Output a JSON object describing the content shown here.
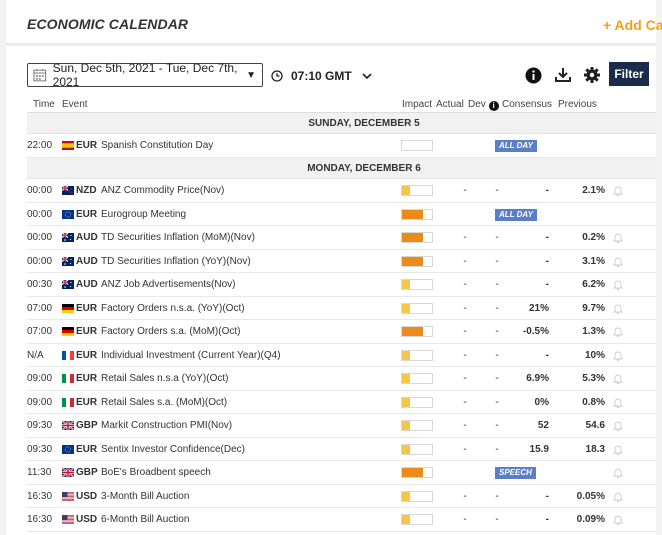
{
  "header": {
    "title": "ECONOMIC CALENDAR",
    "add_calendar": "+ Add Ca"
  },
  "toolbar": {
    "date_range": "Sun, Dec 5th, 2021 -  Tue, Dec 7th, 2021",
    "timezone": "07:10 GMT",
    "filter_label": "Filter"
  },
  "columns": {
    "time": "Time",
    "event": "Event",
    "impact": "Impact",
    "actual": "Actual",
    "dev": "Dev",
    "consensus": "Consensus",
    "previous": "Previous"
  },
  "days": [
    {
      "label": "SUNDAY, DECEMBER 5",
      "events": [
        {
          "time": "22:00",
          "flag": "es",
          "currency": "EUR",
          "event": "Spanish Constitution Day",
          "impact": 0,
          "tag": "ALL DAY",
          "actual": "",
          "dev": "",
          "consensus": "",
          "previous": "",
          "bell": false
        }
      ]
    },
    {
      "label": "MONDAY, DECEMBER 6",
      "events": [
        {
          "time": "00:00",
          "flag": "nz",
          "currency": "NZD",
          "event": "ANZ Commodity Price(Nov)",
          "impact": 0.25,
          "tag": "",
          "actual": "-",
          "dev": "-",
          "consensus": "-",
          "previous": "2.1%",
          "bell": true
        },
        {
          "time": "00:00",
          "flag": "eu",
          "currency": "EUR",
          "event": "Eurogroup Meeting",
          "impact": 0.7,
          "tag": "ALL DAY",
          "actual": "",
          "dev": "",
          "consensus": "",
          "previous": "",
          "bell": false
        },
        {
          "time": "00:00",
          "flag": "au",
          "currency": "AUD",
          "event": "TD Securities Inflation (MoM)(Nov)",
          "impact": 0.7,
          "tag": "",
          "actual": "-",
          "dev": "-",
          "consensus": "-",
          "previous": "0.2%",
          "bell": true
        },
        {
          "time": "00:00",
          "flag": "au",
          "currency": "AUD",
          "event": "TD Securities Inflation (YoY)(Nov)",
          "impact": 0.7,
          "tag": "",
          "actual": "-",
          "dev": "-",
          "consensus": "-",
          "previous": "3.1%",
          "bell": true
        },
        {
          "time": "00:30",
          "flag": "au",
          "currency": "AUD",
          "event": "ANZ Job Advertisements(Nov)",
          "impact": 0.25,
          "tag": "",
          "actual": "-",
          "dev": "-",
          "consensus": "-",
          "previous": "6.2%",
          "bell": true
        },
        {
          "time": "07:00",
          "flag": "de",
          "currency": "EUR",
          "event": "Factory Orders n.s.a. (YoY)(Oct)",
          "impact": 0.25,
          "tag": "",
          "actual": "-",
          "dev": "-",
          "consensus": "21%",
          "previous": "9.7%",
          "bell": true
        },
        {
          "time": "07:00",
          "flag": "de",
          "currency": "EUR",
          "event": "Factory Orders s.a. (MoM)(Oct)",
          "impact": 0.7,
          "tag": "",
          "actual": "-",
          "dev": "-",
          "consensus": "-0.5%",
          "previous": "1.3%",
          "bell": true
        },
        {
          "time": "N/A",
          "flag": "fr",
          "currency": "EUR",
          "event": "Individual Investment (Current Year)(Q4)",
          "impact": 0.25,
          "tag": "",
          "actual": "-",
          "dev": "-",
          "consensus": "-",
          "previous": "10%",
          "bell": true
        },
        {
          "time": "09:00",
          "flag": "it",
          "currency": "EUR",
          "event": "Retail Sales n.s.a (YoY)(Oct)",
          "impact": 0.25,
          "tag": "",
          "actual": "-",
          "dev": "-",
          "consensus": "6.9%",
          "previous": "5.3%",
          "bell": true
        },
        {
          "time": "09:00",
          "flag": "it",
          "currency": "EUR",
          "event": "Retail Sales s.a. (MoM)(Oct)",
          "impact": 0.25,
          "tag": "",
          "actual": "-",
          "dev": "-",
          "consensus": "0%",
          "previous": "0.8%",
          "bell": true
        },
        {
          "time": "09:30",
          "flag": "gb",
          "currency": "GBP",
          "event": "Markit Construction PMI(Nov)",
          "impact": 0.25,
          "tag": "",
          "actual": "-",
          "dev": "-",
          "consensus": "52",
          "previous": "54.6",
          "bell": true
        },
        {
          "time": "09:30",
          "flag": "eu",
          "currency": "EUR",
          "event": "Sentix Investor Confidence(Dec)",
          "impact": 0.25,
          "tag": "",
          "actual": "-",
          "dev": "-",
          "consensus": "15.9",
          "previous": "18.3",
          "bell": true
        },
        {
          "time": "11:30",
          "flag": "gb",
          "currency": "GBP",
          "event": "BoE's Broadbent speech",
          "impact": 0.7,
          "tag": "SPEECH",
          "actual": "",
          "dev": "",
          "consensus": "",
          "previous": "",
          "bell": true
        },
        {
          "time": "16:30",
          "flag": "us",
          "currency": "USD",
          "event": "3-Month Bill Auction",
          "impact": 0.25,
          "tag": "",
          "actual": "-",
          "dev": "-",
          "consensus": "-",
          "previous": "0.05%",
          "bell": true
        },
        {
          "time": "16:30",
          "flag": "us",
          "currency": "USD",
          "event": "6-Month Bill Auction",
          "impact": 0.25,
          "tag": "",
          "actual": "-",
          "dev": "-",
          "consensus": "-",
          "previous": "0.09%",
          "bell": true
        }
      ]
    }
  ],
  "colors": {
    "impact_low": "#f5c64a",
    "impact_medium": "#ea8b1c",
    "tag_bg": "#5b7fc7",
    "filter_bg": "#1b2b4b",
    "accent": "#f0a020"
  }
}
